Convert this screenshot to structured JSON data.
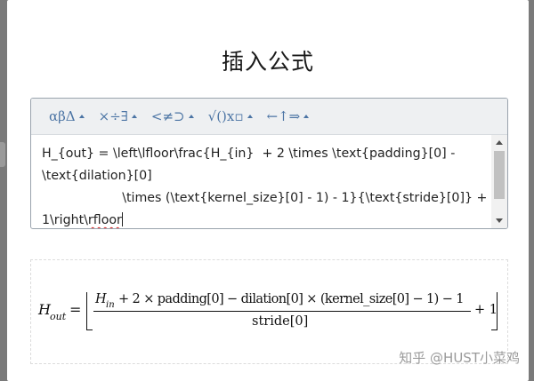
{
  "dialog": {
    "title": "插入公式"
  },
  "toolbar": {
    "groups": [
      {
        "name": "greek",
        "label": "αβΔ"
      },
      {
        "name": "operators",
        "label": "×÷∃"
      },
      {
        "name": "relations",
        "label": "<≠⊃"
      },
      {
        "name": "functions",
        "label": "√()x▫"
      },
      {
        "name": "arrows",
        "label": "←↑⇒"
      }
    ]
  },
  "editor": {
    "line1": "H_{out} = \\left\\lfloor\\frac{H_{in}  + 2 \\times \\text{padding}[0] -",
    "line2": "\\text{dilation}[0]",
    "line3": "                    \\times (\\text{kernel_size}[0] - 1) - 1}{\\text{stride}[0]} +",
    "line4_a": "1\\right\\",
    "line4_b": "rfloor"
  },
  "preview": {
    "lhs": "H",
    "lhs_sub": "out",
    "equals": "=",
    "num_H": "H",
    "num_sub": "in",
    "num_rest": "+ 2 × padding[0] − dilation[0] × (kernel_size[0] − 1) − 1",
    "den": "stride[0]",
    "tail": "+ 1"
  },
  "watermark": "知乎 @HUST小菜鸡"
}
